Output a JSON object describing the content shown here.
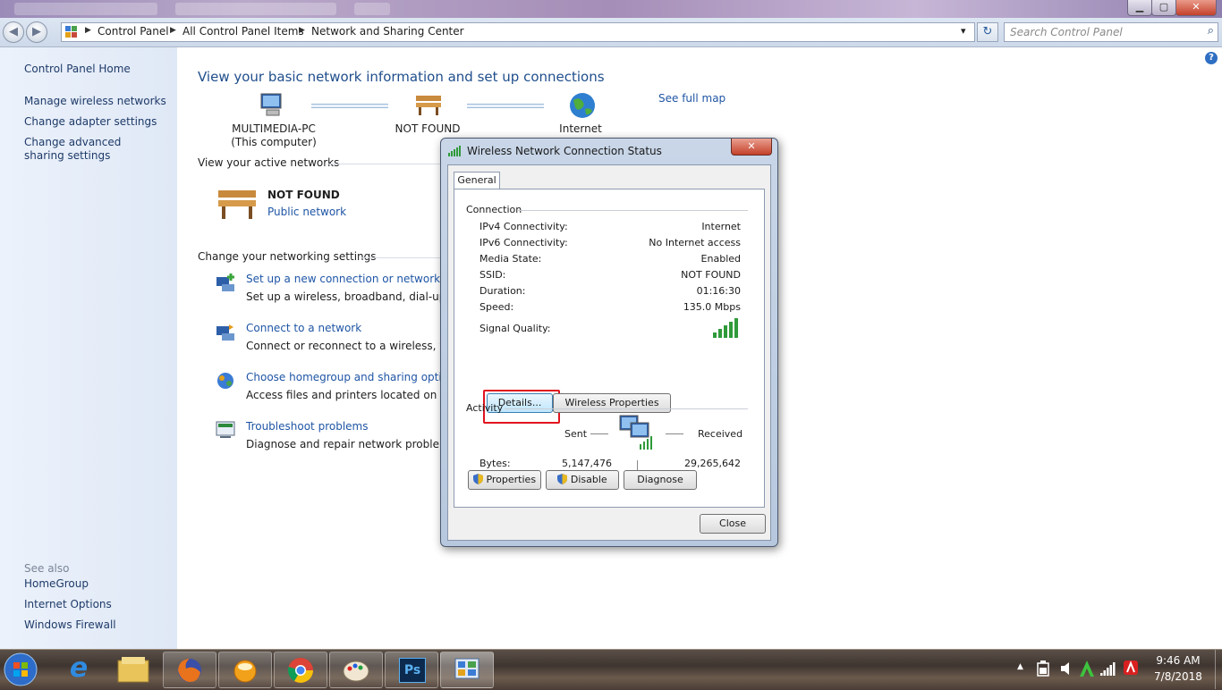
{
  "window": {
    "title_strip_tabs": [
      "",
      "",
      ""
    ],
    "buttons": {
      "minimize": "▁",
      "maximize": "▢",
      "close": "✕"
    }
  },
  "address_bar": {
    "back_glyph": "◀",
    "forward_glyph": "▶",
    "breadcrumb": [
      "Control Panel",
      "All Control Panel Items",
      "Network and Sharing Center"
    ],
    "search_placeholder": "Search Control Panel",
    "refresh_glyph": "↻",
    "dropdown_glyph": "▾",
    "search_glyph": "⌕"
  },
  "sidebar": {
    "home": "Control Panel Home",
    "links": [
      "Manage wireless networks",
      "Change adapter settings",
      "Change advanced sharing settings"
    ],
    "see_also_label": "See also",
    "see_also": [
      "HomeGroup",
      "Internet Options",
      "Windows Firewall"
    ]
  },
  "main": {
    "title": "View your basic network information and set up connections",
    "see_full_map": "See full map",
    "map": {
      "computer_name": "MULTIMEDIA-PC",
      "computer_sub": "(This computer)",
      "network_name": "NOT FOUND",
      "internet": "Internet"
    },
    "active_networks_label": "View your active networks",
    "active_network": {
      "name": "NOT FOUND",
      "type": "Public network"
    },
    "networking_settings_label": "Change your networking settings",
    "tasks": [
      {
        "link": "Set up a new connection or network",
        "desc": "Set up a wireless, broadband, dial-up, ad"
      },
      {
        "link": "Connect to a network",
        "desc": "Connect or reconnect to a wireless, wired"
      },
      {
        "link": "Choose homegroup and sharing options",
        "desc": "Access files and printers located on other"
      },
      {
        "link": "Troubleshoot problems",
        "desc": "Diagnose and repair network problems, o"
      }
    ],
    "help_glyph": "?"
  },
  "dialog": {
    "title": "Wireless Network Connection Status",
    "close_glyph": "✕",
    "tab": "General",
    "connection_label": "Connection",
    "rows": [
      {
        "k": "IPv4 Connectivity:",
        "v": "Internet"
      },
      {
        "k": "IPv6 Connectivity:",
        "v": "No Internet access"
      },
      {
        "k": "Media State:",
        "v": "Enabled"
      },
      {
        "k": "SSID:",
        "v": "NOT FOUND"
      },
      {
        "k": "Duration:",
        "v": "01:16:30"
      },
      {
        "k": "Speed:",
        "v": "135.0 Mbps"
      }
    ],
    "signal_label": "Signal Quality:",
    "signal_bars_filled": 5,
    "details_button": "Details...",
    "wireless_properties_button": "Wireless Properties",
    "activity_label": "Activity",
    "sent_label": "Sent",
    "received_label": "Received",
    "bytes_label": "Bytes:",
    "bytes_sent": "5,147,476",
    "bytes_received": "29,265,642",
    "properties_button": "Properties",
    "disable_button": "Disable",
    "diagnose_button": "Diagnose",
    "close_button": "Close"
  },
  "taskbar": {
    "time": "9:46 AM",
    "date": "7/8/2018",
    "apps": [
      "start-orb",
      "internet-explorer",
      "file-explorer",
      "firefox",
      "app-orange",
      "chrome",
      "paint",
      "photoshop",
      "control-panel"
    ],
    "photoshop_glyph": "Ps",
    "ie_glyph": "e",
    "tray_arrow": "▲"
  },
  "colors": {
    "link": "#1f55a5",
    "title": "#1f4e8c",
    "highlight": "#e0141e",
    "sidebar_bg": "#e6eef9"
  }
}
